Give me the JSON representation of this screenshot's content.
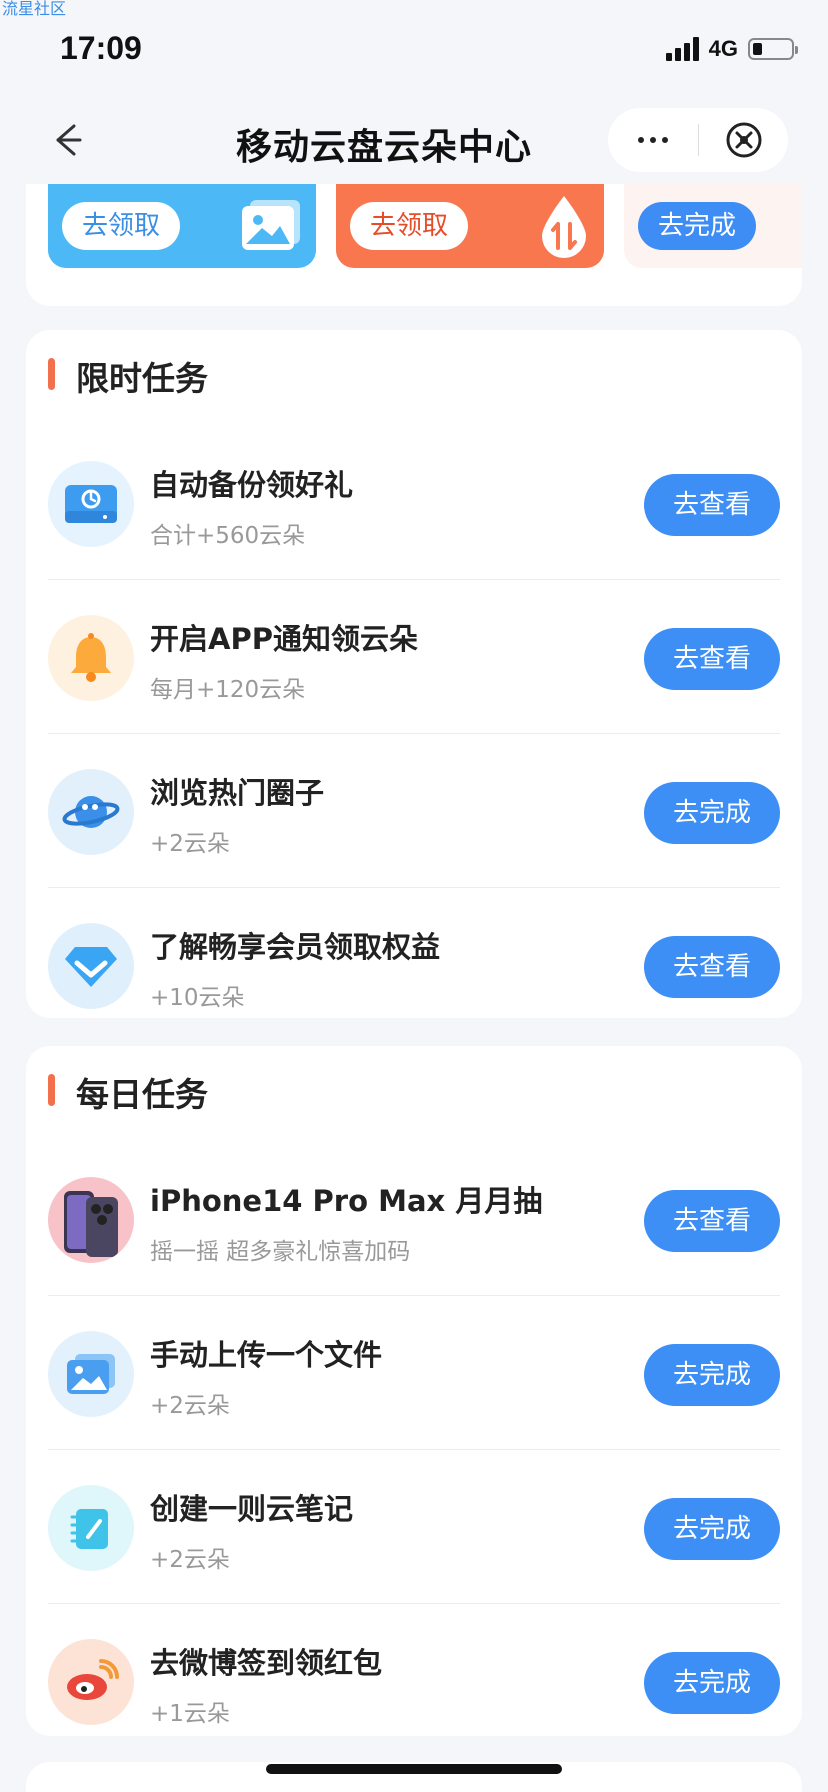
{
  "watermark": "流星社区",
  "status_bar": {
    "time": "17:09",
    "network": "4G"
  },
  "nav": {
    "title": "移动云盘云朵中心"
  },
  "top_banners": [
    {
      "label": "去领取",
      "icon": "image-gallery-icon"
    },
    {
      "label": "去领取",
      "icon": "transfer-drop-icon"
    },
    {
      "label": "去完成"
    }
  ],
  "sections": {
    "limited": {
      "title": "限时任务",
      "tasks": [
        {
          "title": "自动备份领好礼",
          "sub": "合计+560云朵",
          "button": "去查看",
          "icon": "backup-disk-icon"
        },
        {
          "title": "开启APP通知领云朵",
          "sub": "每月+120云朵",
          "button": "去查看",
          "icon": "bell-icon"
        },
        {
          "title": "浏览热门圈子",
          "sub": "+2云朵",
          "button": "去完成",
          "icon": "planet-icon"
        },
        {
          "title": "了解畅享会员领取权益",
          "sub": "+10云朵",
          "button": "去查看",
          "icon": "diamond-icon"
        }
      ]
    },
    "daily": {
      "title": "每日任务",
      "tasks": [
        {
          "title": "iPhone14 Pro Max 月月抽",
          "sub": "摇一摇 超多豪礼惊喜加码",
          "button": "去查看",
          "icon": "phone-image-icon"
        },
        {
          "title": "手动上传一个文件",
          "sub": "+2云朵",
          "button": "去完成",
          "icon": "upload-image-icon"
        },
        {
          "title": "创建一则云笔记",
          "sub": "+2云朵",
          "button": "去完成",
          "icon": "note-icon"
        },
        {
          "title": "去微博签到领红包",
          "sub": "+1云朵",
          "button": "去完成",
          "icon": "weibo-icon"
        }
      ]
    }
  },
  "colors": {
    "primary_button": "#3d8ff5",
    "accent_bar": "#f2704b",
    "background": "#f5f6fa"
  }
}
